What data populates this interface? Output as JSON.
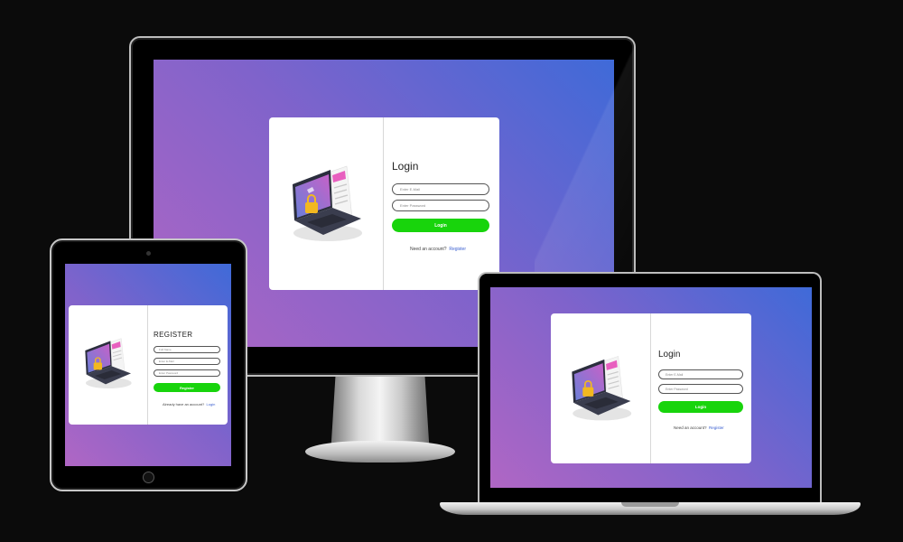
{
  "desktop": {
    "title": "Login",
    "fields": [
      {
        "placeholder": "Enter E-Mail"
      },
      {
        "placeholder": "Enter Password"
      }
    ],
    "button_label": "Login",
    "footer_text": "Need an account?",
    "footer_link": "Register"
  },
  "tablet": {
    "title": "REGISTER",
    "fields": [
      {
        "placeholder": "Full Name"
      },
      {
        "placeholder": "Enter E-Mail"
      },
      {
        "placeholder": "Enter Password"
      }
    ],
    "button_label": "Register",
    "footer_text": "Already have an account?",
    "footer_link": "Login"
  },
  "laptop": {
    "title": "Login",
    "fields": [
      {
        "placeholder": "Enter E-Mail"
      },
      {
        "placeholder": "Enter Password"
      }
    ],
    "button_label": "Login",
    "footer_text": "Need an account?",
    "footer_link": "Register"
  },
  "colors": {
    "gradient_start": "#3f6ad8",
    "gradient_end": "#b066c4",
    "button": "#18d40c",
    "link": "#3a5fd0"
  },
  "icons": [
    "laptop-lock-illustration-icon"
  ]
}
